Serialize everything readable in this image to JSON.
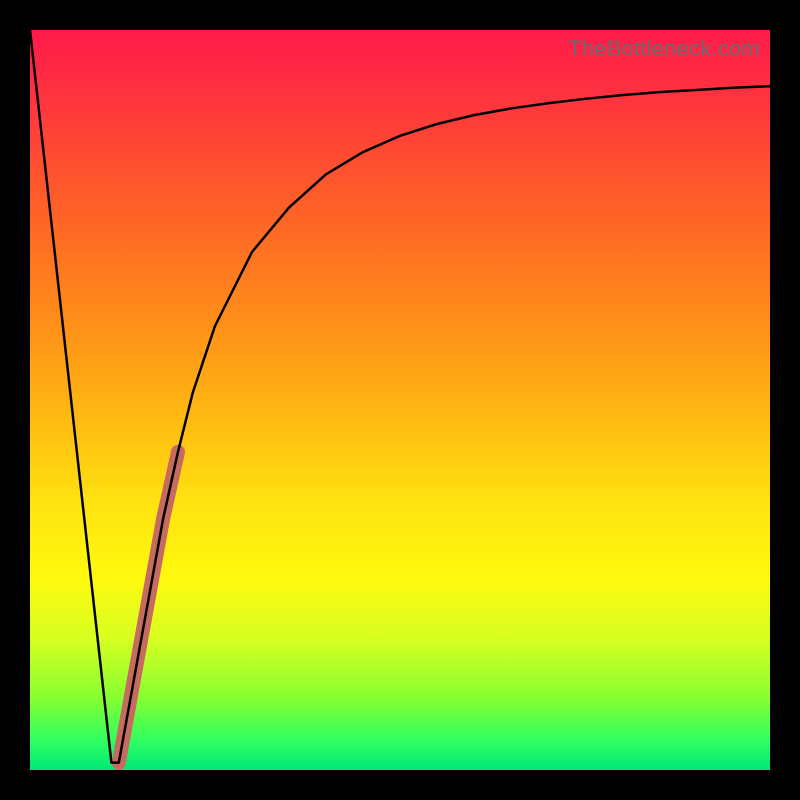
{
  "watermark": "TheBottleneck.com",
  "colors": {
    "background": "#000000",
    "gradient_top": "#ff1a4a",
    "gradient_bottom": "#00e878",
    "curve": "#000000",
    "highlight": "#c76a5f",
    "watermark_text": "#6a6a6a"
  },
  "chart_data": {
    "type": "line",
    "title": "",
    "xlabel": "",
    "ylabel": "",
    "xlim": [
      0,
      100
    ],
    "ylim": [
      0,
      100
    ],
    "grid": false,
    "legend": false,
    "series": [
      {
        "name": "bottleneck-curve",
        "x": [
          0,
          2,
          4,
          6,
          8,
          10,
          11,
          12,
          14,
          16,
          18,
          20,
          22,
          25,
          30,
          35,
          40,
          45,
          50,
          55,
          60,
          65,
          70,
          75,
          80,
          85,
          90,
          95,
          100
        ],
        "y": [
          100,
          82,
          64,
          46,
          28,
          10,
          1,
          1,
          12,
          23,
          34,
          43,
          51,
          60,
          70,
          76,
          80.5,
          83.5,
          85.7,
          87.3,
          88.5,
          89.4,
          90.1,
          90.7,
          91.2,
          91.6,
          91.9,
          92.2,
          92.4
        ]
      },
      {
        "name": "highlight-segment",
        "x": [
          12,
          14,
          16,
          18,
          20
        ],
        "y": [
          1,
          12,
          23,
          34,
          43
        ]
      }
    ],
    "annotations": []
  }
}
